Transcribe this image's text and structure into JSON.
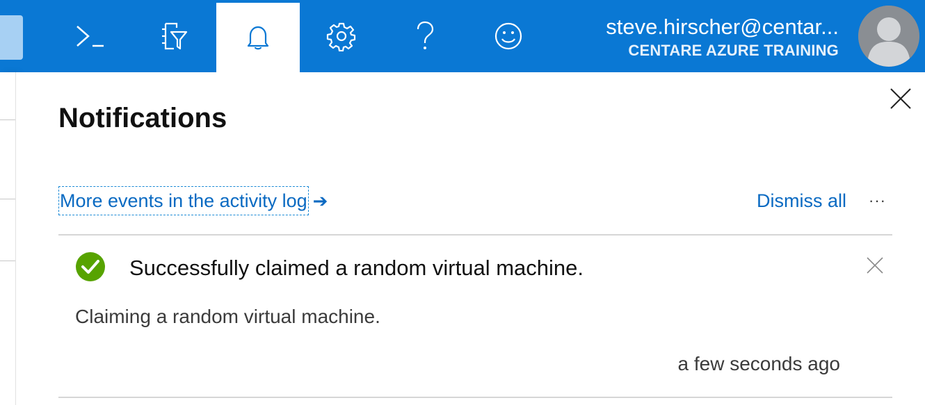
{
  "topbar": {
    "background": "#0a78d4",
    "buttons": [
      {
        "name": "cloud-shell",
        "icon": "terminal-icon"
      },
      {
        "name": "directory-filter",
        "icon": "directory-filter-icon"
      },
      {
        "name": "notifications",
        "icon": "bell-icon",
        "active": true
      },
      {
        "name": "settings",
        "icon": "gear-icon"
      },
      {
        "name": "help",
        "icon": "question-icon"
      },
      {
        "name": "feedback",
        "icon": "smiley-icon"
      }
    ],
    "account": {
      "email": "steve.hirscher@centar...",
      "tenant": "CENTARE AZURE TRAINING"
    }
  },
  "panel": {
    "title": "Notifications",
    "activity_link": "More events in the activity log",
    "activity_arrow": "➔",
    "dismiss_all": "Dismiss all",
    "more": "···",
    "notifications": [
      {
        "status": "success",
        "status_color": "#57a300",
        "title": "Successfully claimed a random virtual machine.",
        "body": "Claiming a random virtual machine.",
        "time": "a few seconds ago"
      }
    ]
  }
}
